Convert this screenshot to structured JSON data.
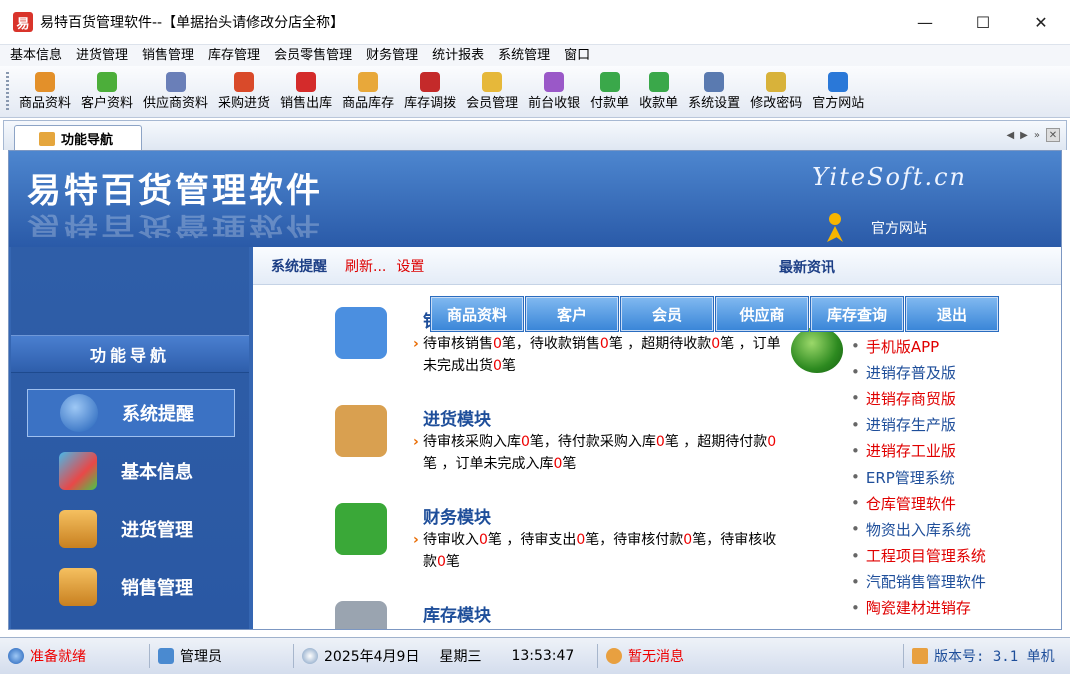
{
  "window": {
    "title": "易特百货管理软件--【单据抬头请修改分店全称】",
    "app_icon_glyph": "易",
    "minimize": "—",
    "maximize": "☐",
    "close": "✕"
  },
  "menu": [
    "基本信息",
    "进货管理",
    "销售管理",
    "库存管理",
    "会员零售管理",
    "财务管理",
    "统计报表",
    "系统管理",
    "窗口"
  ],
  "toolbar": [
    {
      "label": "商品资料",
      "icon": "product-icon",
      "color": "#e3902a"
    },
    {
      "label": "客户资料",
      "icon": "customer-icon",
      "color": "#4cae3a"
    },
    {
      "label": "供应商资料",
      "icon": "supplier-icon",
      "color": "#6a7fb8"
    },
    {
      "label": "采购进货",
      "icon": "truck-icon",
      "color": "#d94a2a"
    },
    {
      "label": "销售出库",
      "icon": "cart-icon",
      "color": "#d42b2b"
    },
    {
      "label": "商品库存",
      "icon": "box-icon",
      "color": "#e8a83a"
    },
    {
      "label": "库存调拨",
      "icon": "transfer-icon",
      "color": "#c42a2a"
    },
    {
      "label": "会员管理",
      "icon": "member-icon",
      "color": "#e6b83a"
    },
    {
      "label": "前台收银",
      "icon": "cashier-icon",
      "color": "#9a58c8"
    },
    {
      "label": "付款单",
      "icon": "payment-icon",
      "color": "#3aa84a"
    },
    {
      "label": "收款单",
      "icon": "receipt-icon",
      "color": "#3aa84a"
    },
    {
      "label": "系统设置",
      "icon": "settings-icon",
      "color": "#5a7ab0"
    },
    {
      "label": "修改密码",
      "icon": "password-icon",
      "color": "#d8b23a"
    },
    {
      "label": "官方网站",
      "icon": "ie-icon",
      "color": "#2a78d8"
    }
  ],
  "tab": {
    "label": "功能导航",
    "scroll_left": "◀",
    "scroll_right": "▶",
    "overflow": "»",
    "close": "✕"
  },
  "banner": {
    "title": "易特百货管理软件",
    "brand": "YiteSoft.cn",
    "site_label": "官方网站"
  },
  "nav": {
    "header": "功能导航",
    "items": [
      {
        "label": "系统提醒",
        "color": "#3a78c8"
      },
      {
        "label": "基本信息",
        "color": "#3aa0d0"
      },
      {
        "label": "进货管理",
        "color": "#e8a83a"
      },
      {
        "label": "销售管理",
        "color": "#e8a83a"
      }
    ]
  },
  "panel": {
    "reminder": "系统提醒",
    "refresh": "刷新...",
    "settings": "设置",
    "news_title": "最新资讯",
    "quick_buttons": [
      "商品资料",
      "客户",
      "会员",
      "供应商",
      "库存查询",
      "退出"
    ]
  },
  "modules": [
    {
      "title": "销售模块",
      "color": "#4b8fe0",
      "parts": [
        "待审核销售",
        "0",
        "笔，待收款销售",
        "0",
        "笔 ，超期待收款",
        "0",
        "笔 ，订单未完成出货",
        "0",
        "笔"
      ]
    },
    {
      "title": "进货模块",
      "color": "#d9a050",
      "parts": [
        "待审核采购入库",
        "0",
        "笔，待付款采购入库",
        "0",
        "笔 ，超期待付款",
        "0",
        "笔 ，订单未完成入库",
        "0",
        "笔"
      ]
    },
    {
      "title": "财务模块",
      "color": "#3aa838",
      "parts": [
        "待审收入",
        "0",
        "笔 ，待审支出",
        "0",
        "笔，待审核付款",
        "0",
        "笔，待审核收款",
        "0",
        "笔"
      ]
    },
    {
      "title": "库存模块",
      "color": "#9aa4b0",
      "parts": []
    }
  ],
  "news": [
    {
      "text": "手机版APP",
      "color": "#e00000"
    },
    {
      "text": "进销存普及版",
      "color": "#1e4e9a"
    },
    {
      "text": "进销存商贸版",
      "color": "#e00000"
    },
    {
      "text": "进销存生产版",
      "color": "#1e4e9a"
    },
    {
      "text": "进销存工业版",
      "color": "#e00000"
    },
    {
      "text": "ERP管理系统",
      "color": "#1e4e9a"
    },
    {
      "text": "仓库管理软件",
      "color": "#e00000"
    },
    {
      "text": "物资出入库系统",
      "color": "#1e4e9a"
    },
    {
      "text": "工程项目管理系统",
      "color": "#e00000"
    },
    {
      "text": "汽配销售管理软件",
      "color": "#1e4e9a"
    },
    {
      "text": "陶瓷建材进销存",
      "color": "#e00000"
    }
  ],
  "status": {
    "ready": "准备就绪",
    "user": "管理员",
    "date": "2025年4月9日",
    "weekday": "星期三",
    "time": "13:53:47",
    "message": "暂无消息",
    "version": "版本号: 3.1 单机"
  }
}
